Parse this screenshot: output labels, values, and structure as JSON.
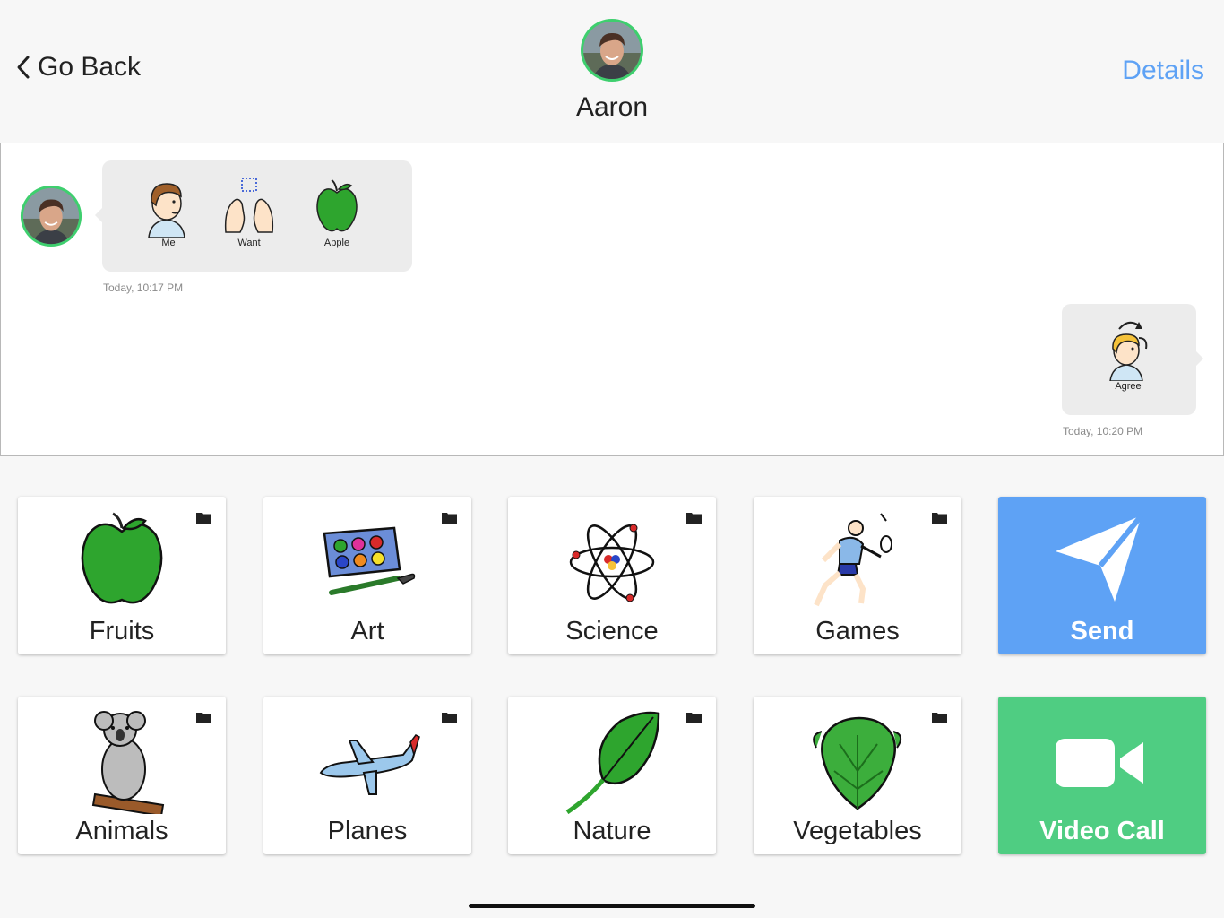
{
  "header": {
    "back_label": "Go Back",
    "contact_name": "Aaron",
    "details_label": "Details"
  },
  "messages": [
    {
      "direction": "incoming",
      "symbols": [
        {
          "icon": "person-me-icon",
          "label": "Me"
        },
        {
          "icon": "want-hands-icon",
          "label": "Want"
        },
        {
          "icon": "apple-icon",
          "label": "Apple"
        }
      ],
      "timestamp": "Today, 10:17 PM"
    },
    {
      "direction": "outgoing",
      "symbols": [
        {
          "icon": "agree-person-icon",
          "label": "Agree"
        }
      ],
      "timestamp": "Today, 10:20 PM"
    }
  ],
  "tiles": [
    {
      "label": "Fruits",
      "icon": "apple-icon",
      "folder": true
    },
    {
      "label": "Art",
      "icon": "paint-palette-icon",
      "folder": true
    },
    {
      "label": "Science",
      "icon": "atom-icon",
      "folder": true
    },
    {
      "label": "Games",
      "icon": "badminton-player-icon",
      "folder": true
    },
    {
      "label": "Send",
      "icon": "paper-plane-icon",
      "folder": false
    },
    {
      "label": "Animals",
      "icon": "koala-icon",
      "folder": true
    },
    {
      "label": "Planes",
      "icon": "airplane-icon",
      "folder": true
    },
    {
      "label": "Nature",
      "icon": "leaf-icon",
      "folder": true
    },
    {
      "label": "Vegetables",
      "icon": "lettuce-icon",
      "folder": true
    },
    {
      "label": "Video Call",
      "icon": "video-camera-icon",
      "folder": false
    }
  ],
  "colors": {
    "accent_blue": "#5ea2f5",
    "send_tile": "#5ea2f5",
    "video_tile": "#4fcd82",
    "avatar_ring": "#3ecf6e",
    "bubble": "#ececec"
  }
}
